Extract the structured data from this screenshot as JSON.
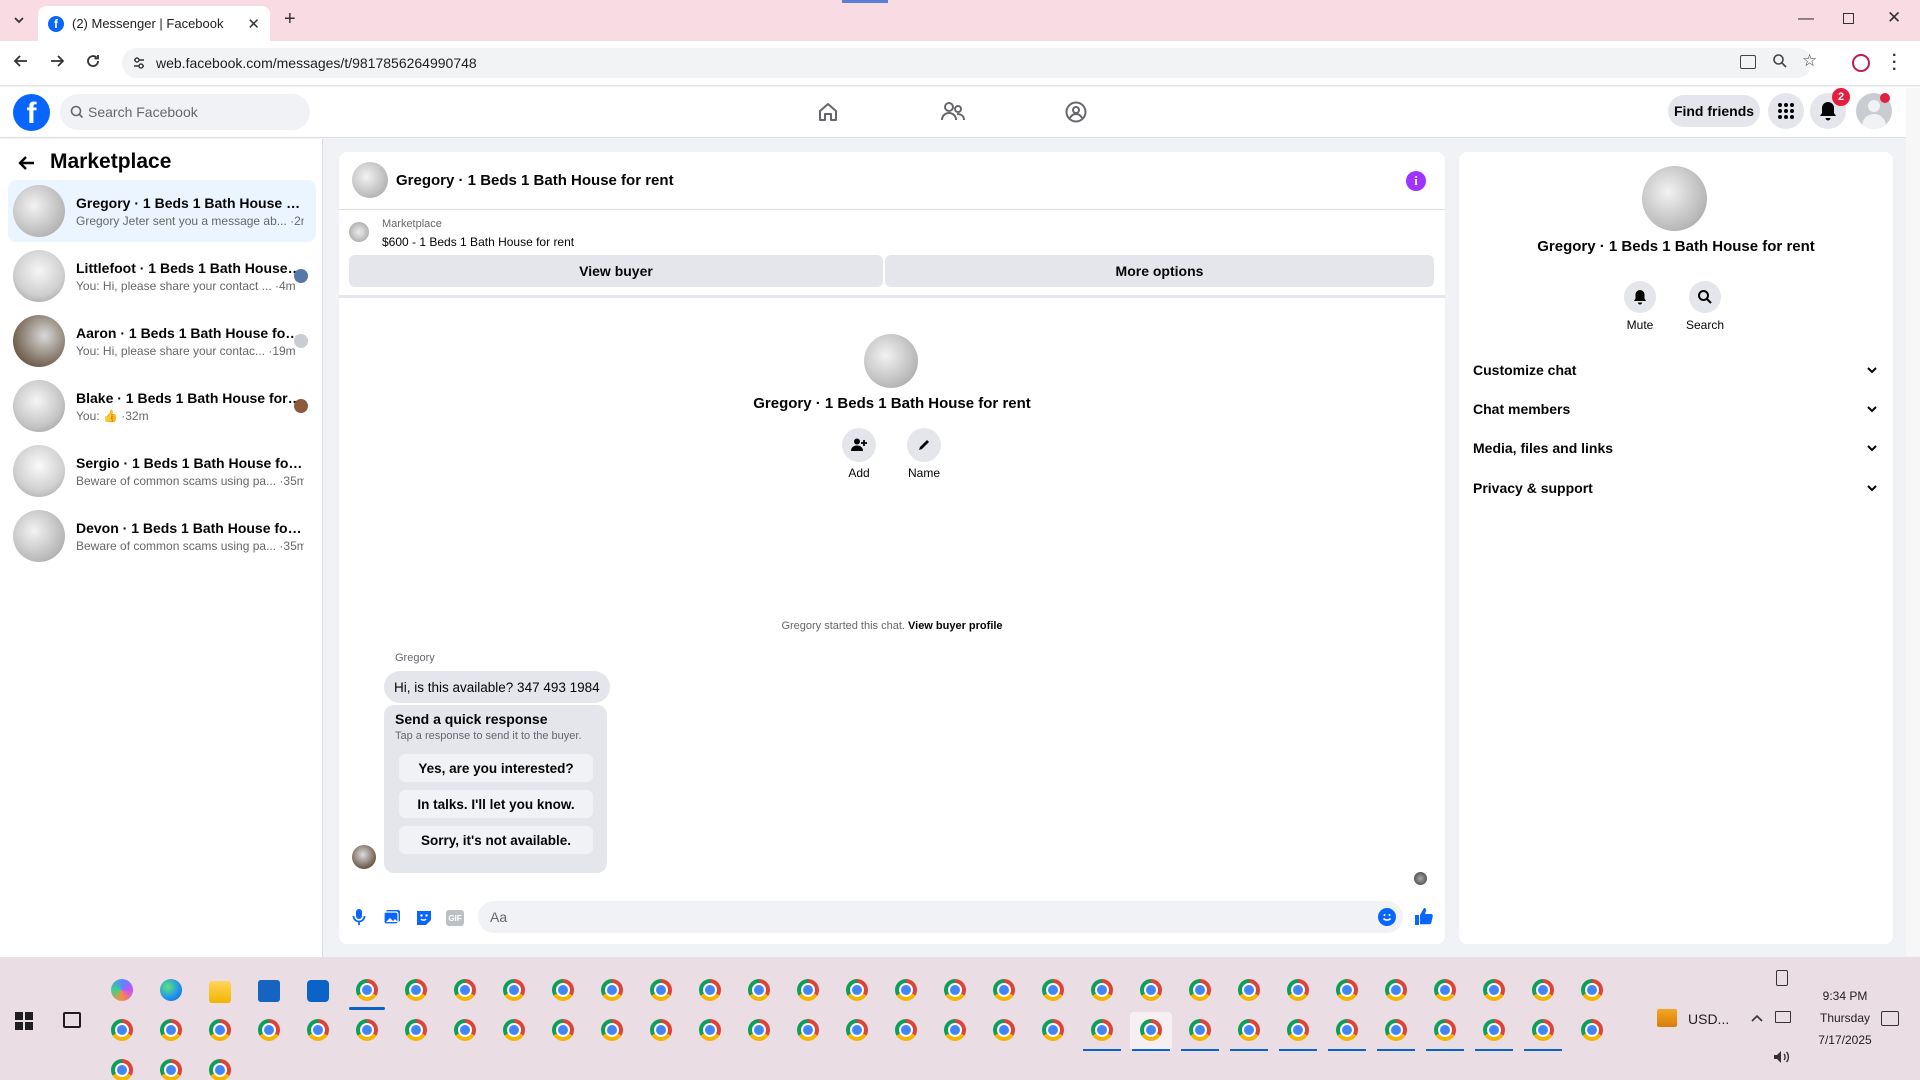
{
  "browser": {
    "tab_title": "(2) Messenger | Facebook",
    "url": "web.facebook.com/messages/t/9817856264990748"
  },
  "fb": {
    "search_placeholder": "Search Facebook",
    "find_friends": "Find friends",
    "notification_count": "2"
  },
  "left": {
    "title": "Marketplace",
    "chats": [
      {
        "name": "Gregory · 1 Beds 1 Bath House for ...",
        "preview": "Gregory Jeter sent you a message ab... ·2m"
      },
      {
        "name": "Littlefoot · 1 Beds 1 Bath House f...",
        "preview": "You: Hi, please share your contact ... ·4m"
      },
      {
        "name": "Aaron · 1 Beds 1 Bath House for ...",
        "preview": "You: Hi, please share your contac... ·19m"
      },
      {
        "name": "Blake · 1 Beds 1 Bath House for r...",
        "preview_prefix": "You:",
        "preview_suffix": "·32m"
      },
      {
        "name": "Sergio · 1 Beds 1 Bath House for rent",
        "preview": "Beware of common scams using pa... ·35m"
      },
      {
        "name": "Devon · 1 Beds 1 Bath House for rent",
        "preview": "Beware of common scams using pa... ·35m"
      }
    ]
  },
  "conversation": {
    "title": "Gregory · 1 Beds 1 Bath House for rent",
    "marketplace_label": "Marketplace",
    "listing": "$600 - 1 Beds 1 Bath House for rent",
    "view_buyer": "View buyer",
    "more_options": "More options",
    "center_name": "Gregory · 1 Beds 1 Bath House for rent",
    "add_label": "Add",
    "name_label": "Name",
    "started_text": "Gregory started this chat.",
    "view_profile": "View buyer profile",
    "sender": "Gregory",
    "message": "Hi, is this available? 347 493 1984",
    "quick_title": "Send a quick response",
    "quick_sub": "Tap a response to send it to the buyer.",
    "quick_responses": [
      "Yes, are you interested?",
      "In talks. I'll let you know.",
      "Sorry, it's not available."
    ],
    "composer_placeholder": "Aa"
  },
  "details": {
    "name": "Gregory · 1 Beds 1 Bath House for rent",
    "mute": "Mute",
    "search": "Search",
    "sections": [
      "Customize chat",
      "Chat members",
      "Media, files and links",
      "Privacy & support"
    ]
  },
  "taskbar": {
    "time": "9:34 PM",
    "day": "Thursday",
    "date": "7/17/2025",
    "currency": "USD..."
  },
  "colors": {
    "fb_blue": "#0866ff",
    "accent_purple": "#a033ff",
    "badge_red": "#e41e3f"
  }
}
